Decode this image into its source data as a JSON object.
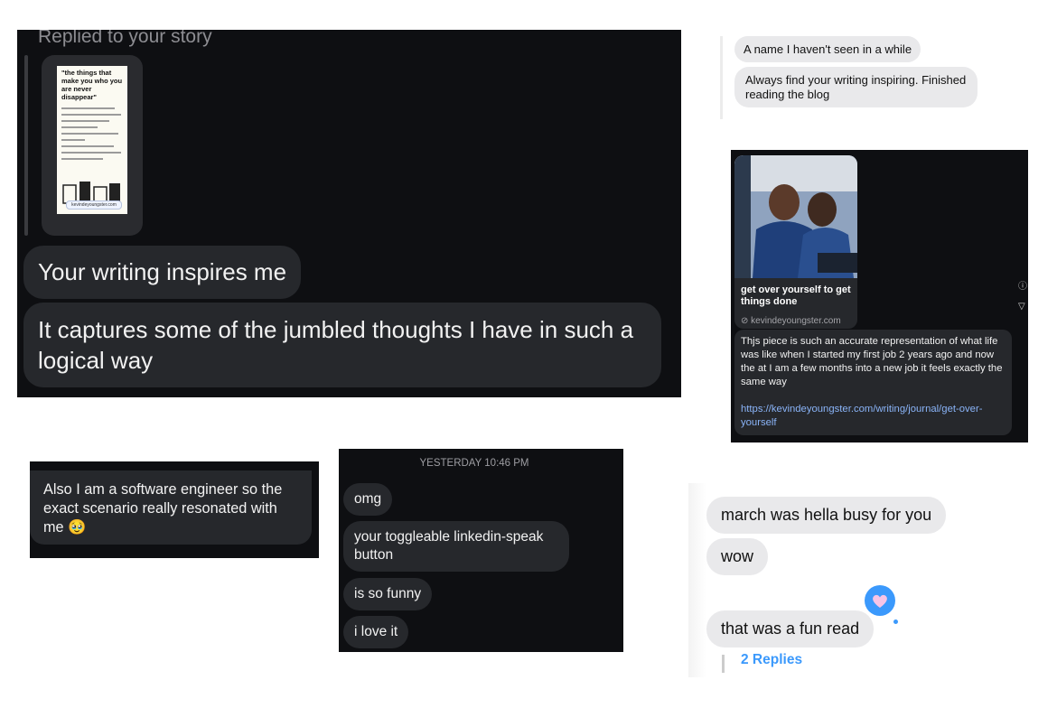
{
  "colors": {
    "dark_background": "#0e0f12",
    "dark_bubble": "#26282c",
    "light_bubble": "#e9e9eb",
    "accent_blue": "#3b99fc",
    "link_blue": "#8ab4f8",
    "reaction_pink": "#f7c4e6"
  },
  "panel1": {
    "story_label": "Replied to your story",
    "story_title": "\"the things that make you who you are never disappear\"",
    "story_url": "kevindeyoungster.com",
    "messages": [
      "Your writing inspires me",
      "It captures some of the jumbled thoughts I have in such a logical way"
    ]
  },
  "panel2": {
    "messages": [
      "A name I haven't seen in a while",
      "Always find your writing inspiring. Finished reading the blog"
    ]
  },
  "panel3": {
    "link_title": "get over yourself to get things done",
    "link_domain": "kevindeyoungster.com",
    "message": "Thjs piece is such an accurate representation of what life was like when I started my first job 2 years ago and now the at I am a few months into a new job it feels exactly the same way",
    "link_text": "https://kevindeyoungster.com/writing/journal/get-over-yourself",
    "icons": [
      "info-icon",
      "filter-icon"
    ]
  },
  "panel4": {
    "message": "Also I am a software engineer so the exact scenario really resonated with me",
    "emoji": "🥹"
  },
  "panel5": {
    "timestamp": "YESTERDAY 10:46 PM",
    "messages": [
      "omg",
      "your toggleable linkedin-speak button",
      "is so funny",
      "i love it"
    ]
  },
  "panel6": {
    "messages": [
      "march was hella busy for you",
      "wow",
      "that was a fun read"
    ],
    "reaction_icon": "heart-icon",
    "replies": "2 Replies"
  }
}
